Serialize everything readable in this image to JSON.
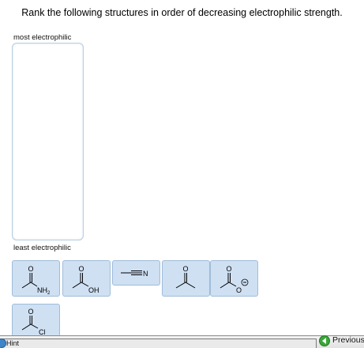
{
  "question": "Rank the following structures in order of decreasing electrophilic strength.",
  "ranking": {
    "top_label": "most electrophilic",
    "bottom_label": "least electrophilic"
  },
  "tiles": [
    {
      "name": "acetamide",
      "atoms": [
        "O",
        "NH",
        "2"
      ]
    },
    {
      "name": "acetic-acid",
      "atoms": [
        "O",
        "OH"
      ]
    },
    {
      "name": "acetonitrile",
      "atoms": [
        "N"
      ]
    },
    {
      "name": "acetone",
      "atoms": [
        "O"
      ]
    },
    {
      "name": "acetate",
      "atoms": [
        "O",
        "O"
      ]
    },
    {
      "name": "acetyl-chloride",
      "atoms": [
        "O",
        "Cl"
      ]
    }
  ],
  "footer": {
    "hint_label": "Hint",
    "previous_label": "Previous"
  },
  "icons": {
    "hint": "hint-icon",
    "previous": "previous-icon"
  }
}
